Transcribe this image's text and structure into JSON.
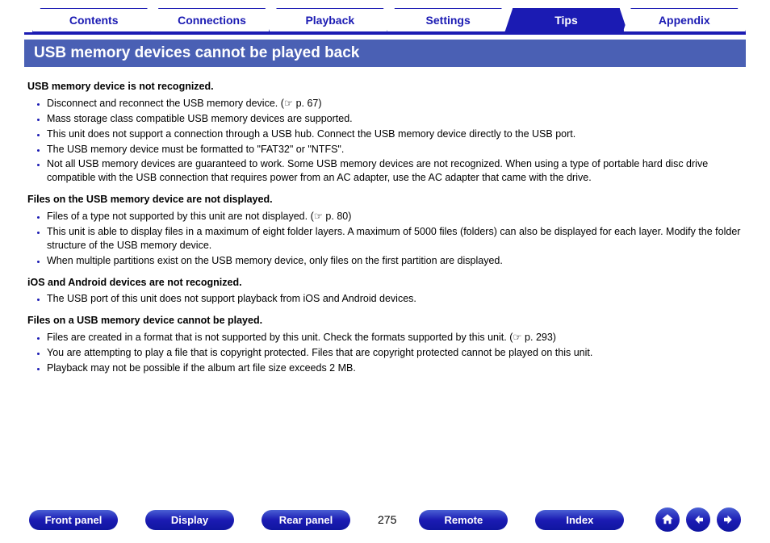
{
  "tabs": [
    {
      "label": "Contents",
      "active": false
    },
    {
      "label": "Connections",
      "active": false
    },
    {
      "label": "Playback",
      "active": false
    },
    {
      "label": "Settings",
      "active": false
    },
    {
      "label": "Tips",
      "active": true
    },
    {
      "label": "Appendix",
      "active": false
    }
  ],
  "title": "USB memory devices cannot be played back",
  "sections": [
    {
      "heading": "USB memory device is not recognized.",
      "items": [
        "Disconnect and reconnect the USB memory device.  (☞ p. 67)",
        "Mass storage class compatible USB memory devices are supported.",
        "This unit does not support a connection through a USB hub. Connect the USB memory device directly to the USB port.",
        "The USB memory device must be formatted to \"FAT32\" or \"NTFS\".",
        "Not all USB memory devices are guaranteed to work. Some USB memory devices are not recognized. When using a type of portable hard disc drive compatible with the USB connection that requires power from an AC adapter, use the AC adapter that came with the drive."
      ]
    },
    {
      "heading": "Files on the USB memory device are not displayed.",
      "items": [
        "Files of a type not supported by this unit are not displayed.  (☞ p. 80)",
        "This unit is able to display files in a maximum of eight folder layers. A maximum of 5000 files (folders) can also be displayed for each layer. Modify the folder structure of the USB memory device.",
        "When multiple partitions exist on the USB memory device, only files on the first partition are displayed."
      ]
    },
    {
      "heading": "iOS and Android devices are not recognized.",
      "items": [
        "The USB port of this unit does not support playback from iOS and Android devices."
      ]
    },
    {
      "heading": "Files on a USB memory device cannot be played.",
      "items": [
        "Files are created in a format that is not supported by this unit. Check the formats supported by this unit.  (☞ p. 293)",
        "You are attempting to play a file that is copyright protected. Files that are copyright protected cannot be played on this unit.",
        "Playback may not be possible if the album art file size exceeds 2 MB."
      ]
    }
  ],
  "footer": {
    "buttons": [
      "Front panel",
      "Display",
      "Rear panel"
    ],
    "page": "275",
    "buttons2": [
      "Remote",
      "Index"
    ]
  }
}
